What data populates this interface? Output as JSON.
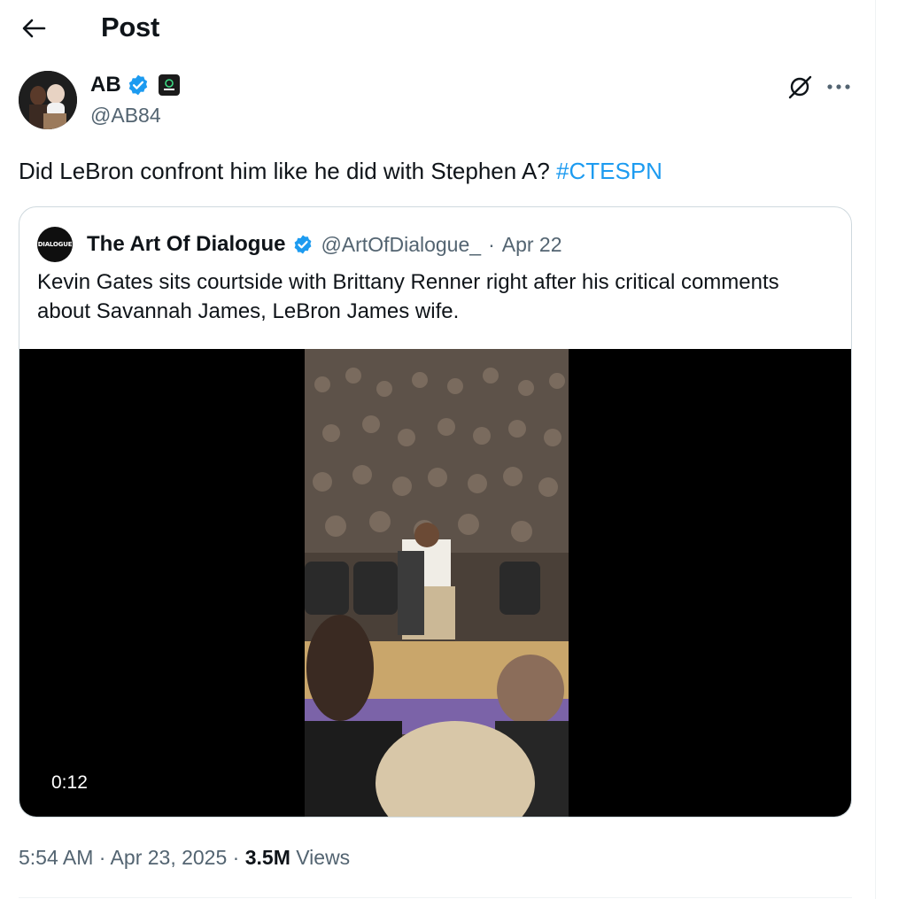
{
  "header": {
    "title": "Post"
  },
  "post": {
    "author": {
      "name": "AB",
      "handle": "@AB84"
    },
    "text": "Did LeBron confront him like he did with Stephen A? ",
    "hashtag": "#CTESPN",
    "timestamp": "5:54 AM · Apr 23, 2025 · ",
    "views_count": "3.5M",
    "views_label": " Views"
  },
  "quote": {
    "name": "The Art Of Dialogue",
    "handle": "@ArtOfDialogue_",
    "separator": "·",
    "date": "Apr 22",
    "text": "Kevin Gates sits courtside with Brittany Renner right after his critical comments about Savannah James, LeBron James wife.",
    "avatar_text": "DIALOGUE",
    "video": {
      "duration": "0:12"
    }
  },
  "colors": {
    "accent": "#1d9bf0",
    "text": "#0f1419",
    "secondary_text": "#536471",
    "border": "#cfd9de"
  },
  "icons": {
    "back": "arrow-left-icon",
    "verified": "verified-badge-icon",
    "affiliate": "affiliate-badge-icon",
    "grok": "grok-icon",
    "more": "more-horizontal-icon"
  }
}
